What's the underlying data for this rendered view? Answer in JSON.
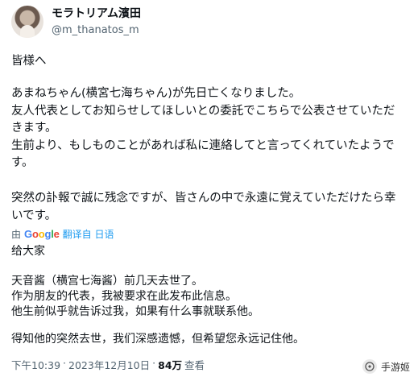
{
  "author": {
    "display_name": "モラトリアム濱田",
    "handle": "@m_thanatos_m"
  },
  "tweet": {
    "greeting": "皆様へ",
    "jp_p1": [
      "あまねちゃん(横宮七海ちゃん)が先日亡くなりました。",
      "友人代表としてお知らせしてほしいとの委託でこちらで公表させていただ",
      "きます。",
      "生前より、もしものことがあれば私に連絡してと言ってくれていたようで",
      "す。"
    ],
    "jp_p2": [
      "突然の訃報で誠に残念ですが、皆さんの中で永遠に覚えていただけたら幸",
      "いです。"
    ],
    "translation": {
      "by": "由",
      "google": "Google",
      "link": "翻译自 日语"
    },
    "cn_greeting": "给大家",
    "cn_p1": [
      "天音酱（横宫七海酱）前几天去世了。",
      "作为朋友的代表，我被要求在此发布此信息。",
      "他生前似乎就告诉过我，如果有什么事就联系他。"
    ],
    "cn_p2": "得知他的突然去世，我们深感遗憾，但希望您永远记住他。"
  },
  "meta": {
    "time": "下午10:39",
    "dot1": "·",
    "date": "2023年12月10日",
    "dot2": "·",
    "views_count": "84万",
    "views_label": "查看"
  },
  "watermark": {
    "text": "手游姬"
  }
}
